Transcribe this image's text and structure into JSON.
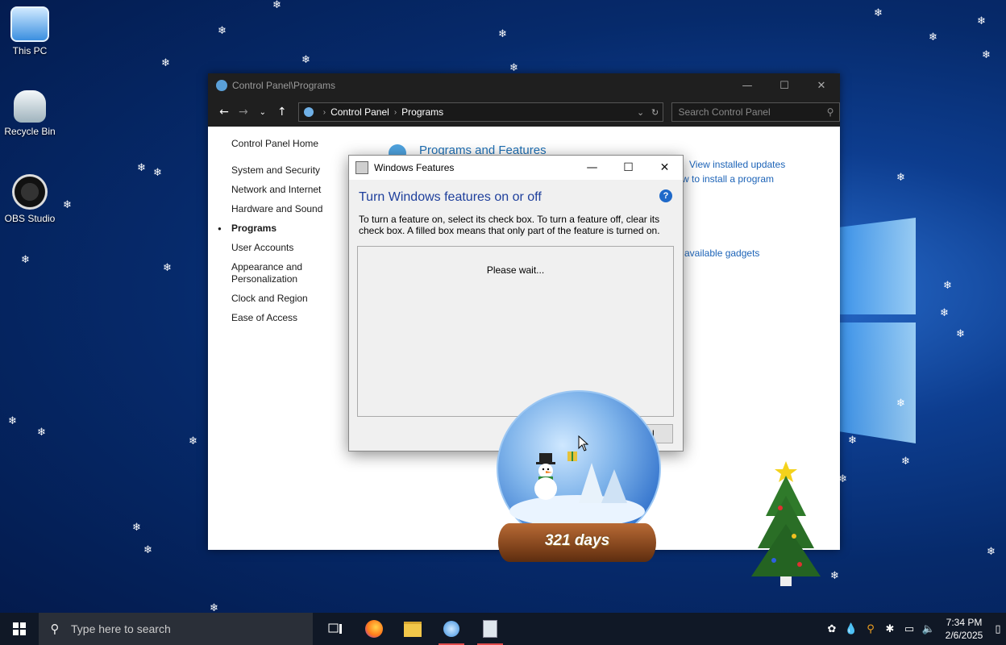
{
  "desktop": {
    "icons": [
      {
        "label": "This PC"
      },
      {
        "label": "Recycle Bin"
      },
      {
        "label": "OBS Studio"
      }
    ]
  },
  "control_panel": {
    "title": "Control Panel\\Programs",
    "breadcrumb": [
      "Control Panel",
      "Programs"
    ],
    "search_placeholder": "Search Control Panel",
    "left_nav": [
      "Control Panel Home",
      "System and Security",
      "Network and Internet",
      "Hardware and Sound",
      "Programs",
      "User Accounts",
      "Appearance and Personalization",
      "Clock and Region",
      "Ease of Access"
    ],
    "section_title": "Programs and Features",
    "links": {
      "view_updates": "View installed updates",
      "how_to_install": "w to install a program",
      "gadgets": "available gadgets"
    }
  },
  "dialog": {
    "title": "Windows Features",
    "heading": "Turn Windows features on or off",
    "description": "To turn a feature on, select its check box. To turn a feature off, clear its check box. A filled box means that only part of the feature is turned on.",
    "status": "Please wait...",
    "cancel_label": "rel"
  },
  "overlay": {
    "globe_text": "321 days"
  },
  "taskbar": {
    "search_placeholder": "Type here to search",
    "time": "7:34 PM",
    "date": "2/6/2025"
  },
  "colors": {
    "accent": "#1e3f9c",
    "link": "#1c63b7"
  }
}
